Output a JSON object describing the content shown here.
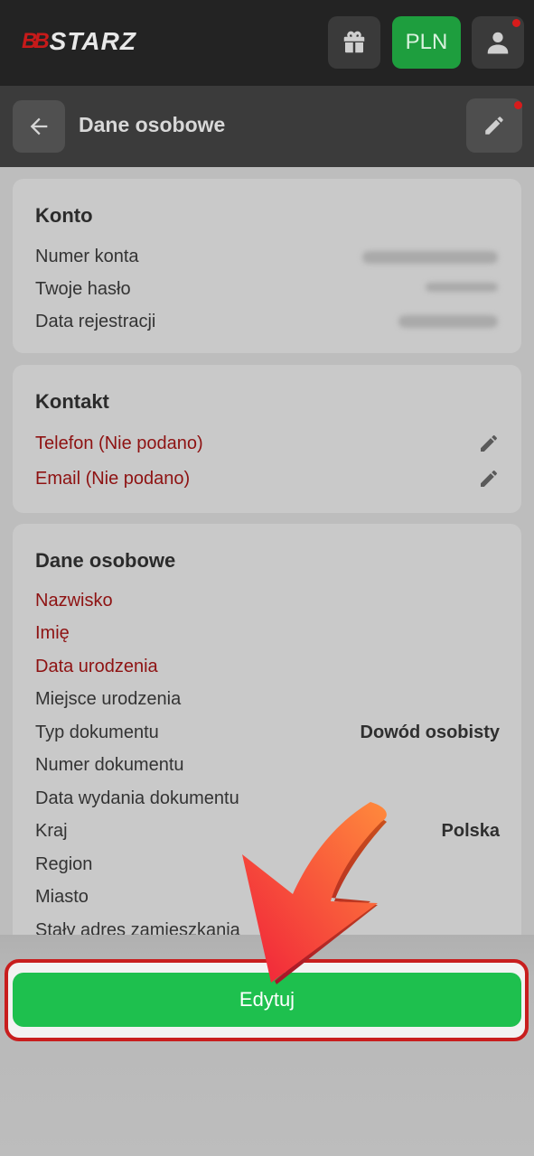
{
  "header": {
    "logo_mark": "BB",
    "logo_text": "STARZ",
    "currency_label": "PLN"
  },
  "subheader": {
    "title": "Dane osobowe"
  },
  "account": {
    "title": "Konto",
    "rows": [
      {
        "label": "Numer konta"
      },
      {
        "label": "Twoje hasło"
      },
      {
        "label": "Data rejestracji"
      }
    ]
  },
  "contact": {
    "title": "Kontakt",
    "rows": [
      {
        "label": "Telefon (Nie podano)"
      },
      {
        "label": "Email (Nie podano)"
      }
    ]
  },
  "personal": {
    "title": "Dane osobowe",
    "rows": [
      {
        "label": "Nazwisko",
        "value": ""
      },
      {
        "label": "Imię",
        "value": ""
      },
      {
        "label": "Data urodzenia",
        "value": ""
      },
      {
        "label": "Miejsce urodzenia",
        "value": ""
      },
      {
        "label": "Typ dokumentu",
        "value": "Dowód osobisty"
      },
      {
        "label": "Numer dokumentu",
        "value": ""
      },
      {
        "label": "Data wydania dokumentu",
        "value": ""
      },
      {
        "label": "Kraj",
        "value": "Polska"
      },
      {
        "label": "Region",
        "value": ""
      },
      {
        "label": "Miasto",
        "value": ""
      },
      {
        "label": "Stały adres zamieszkania",
        "value": ""
      }
    ]
  },
  "footer": {
    "edit_label": "Edytuj"
  },
  "icons": {
    "gift": "gift-icon",
    "user": "user-icon",
    "back": "arrow-left-icon",
    "edit": "pencil-icon"
  },
  "colors": {
    "accent_green": "#1ec04e",
    "required_red": "#8e1212",
    "highlight_red": "#c81e1e"
  }
}
